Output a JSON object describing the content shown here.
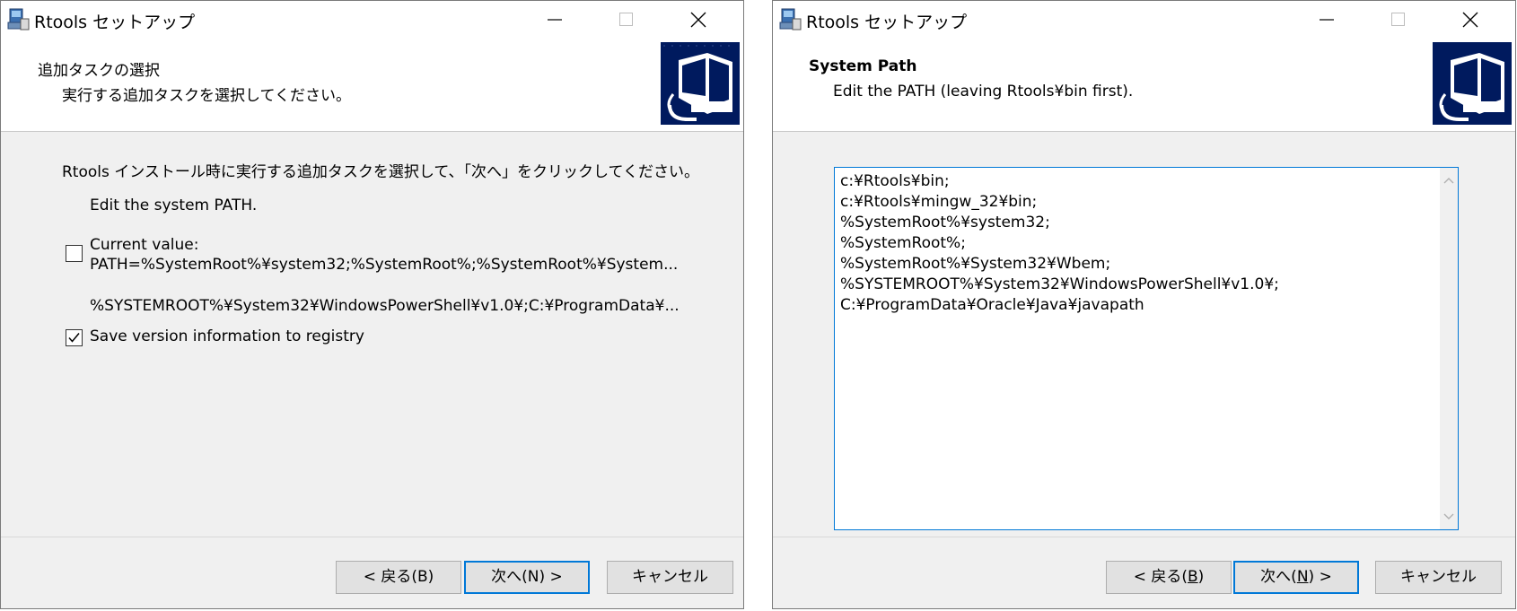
{
  "left_window": {
    "title": "Rtools セットアップ",
    "header_title": "追加タスクの選択",
    "header_subtitle": "実行する追加タスクを選択してください。",
    "intro": "Rtools インストール時に実行する追加タスクを選択して、「次へ」をクリックしてください。",
    "task_group": "Edit the system PATH.",
    "current_value_label": "Current value:",
    "current_value_line1": "PATH=%SystemRoot%¥system32;%SystemRoot%;%SystemRoot%¥System...",
    "current_value_line2": "%SYSTEMROOT%¥System32¥WindowsPowerShell¥v1.0¥;C:¥ProgramData¥...",
    "current_value_checked": false,
    "save_version_label": "Save version information to registry",
    "save_version_checked": true,
    "back_label": "< 戻る(B)",
    "next_label": "次へ(N) >",
    "cancel_label": "キャンセル"
  },
  "right_window": {
    "title": "Rtools セットアップ",
    "header_title": "System Path",
    "header_subtitle": "Edit the PATH (leaving Rtools¥bin first).",
    "path_lines": [
      "c:¥Rtools¥bin;",
      "c:¥Rtools¥mingw_32¥bin;",
      "%SystemRoot%¥system32;",
      "%SystemRoot%;",
      "%SystemRoot%¥System32¥Wbem;",
      "%SYSTEMROOT%¥System32¥WindowsPowerShell¥v1.0¥;",
      "C:¥ProgramData¥Oracle¥Java¥javapath"
    ],
    "back_label_prefix": "< 戻る(",
    "back_label_key": "B",
    "back_label_suffix": ")",
    "next_label_prefix": "次へ(",
    "next_label_key": "N",
    "next_label_suffix": ") >",
    "cancel_label": "キャンセル"
  },
  "colors": {
    "accent": "#0078d7",
    "window_bg": "#f0f0f0",
    "button_bg": "#e1e1e1"
  },
  "icons": {
    "app": "installer-app-icon",
    "header": "installer-computer-icon"
  }
}
